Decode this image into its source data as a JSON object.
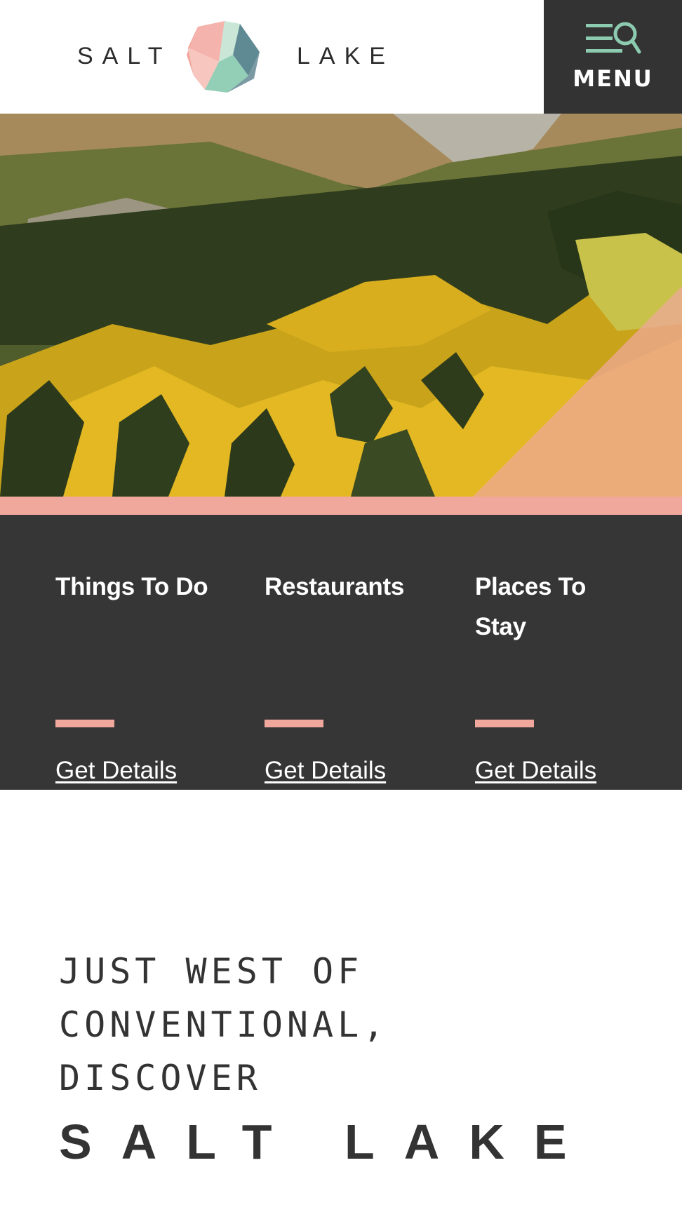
{
  "header": {
    "logo_left": "SALT",
    "logo_right": "LAKE",
    "menu_label": "MENU",
    "menu_icon": "menu-search-icon"
  },
  "colors": {
    "dark": "#333333",
    "accent_pink": "#f0a79c",
    "accent_mint": "#8ccbb0"
  },
  "links": [
    {
      "title": "Things To Do",
      "link": "Get Details"
    },
    {
      "title": "Restaurants",
      "link": "Get Details"
    },
    {
      "title": "Places To Stay",
      "link": "Get Details"
    }
  ],
  "tagline": {
    "lines": [
      "JUST WEST OF",
      "CONVENTIONAL,",
      "DISCOVER"
    ],
    "big": "SALT LAKE"
  }
}
